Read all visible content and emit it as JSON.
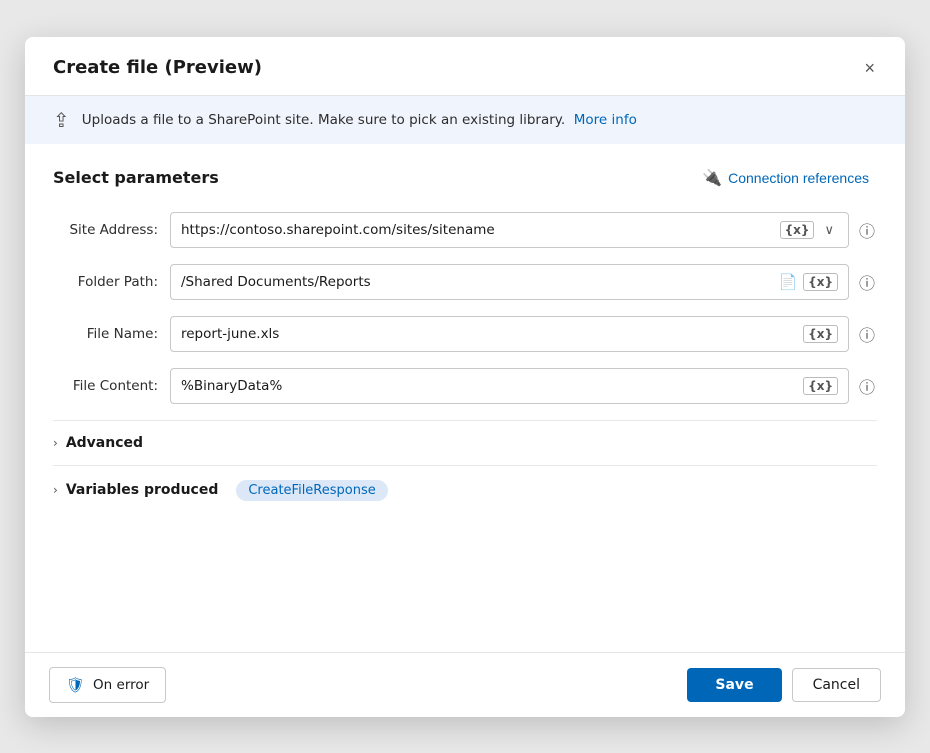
{
  "dialog": {
    "title": "Create file (Preview)",
    "close_label": "×"
  },
  "info_banner": {
    "text": "Uploads a file to a SharePoint site. Make sure to pick an existing library.",
    "link_text": "More info"
  },
  "section": {
    "title": "Select parameters",
    "connection_references_label": "Connection references"
  },
  "fields": [
    {
      "label": "Site Address:",
      "value": "https://contoso.sharepoint.com/sites/sitename",
      "badge": "{x}",
      "has_chevron": true,
      "has_file_icon": false,
      "info": true
    },
    {
      "label": "Folder Path:",
      "value": "/Shared Documents/Reports",
      "badge": "{x}",
      "has_chevron": false,
      "has_file_icon": true,
      "info": true
    },
    {
      "label": "File Name:",
      "value": "report-june.xls",
      "badge": "{x}",
      "has_chevron": false,
      "has_file_icon": false,
      "info": true
    },
    {
      "label": "File Content:",
      "value": "%BinaryData%",
      "badge": "{x}",
      "has_chevron": false,
      "has_file_icon": false,
      "info": true
    }
  ],
  "collapsible": {
    "advanced_label": "Advanced",
    "variables_label": "Variables produced",
    "variable_badge": "CreateFileResponse"
  },
  "footer": {
    "on_error_label": "On error",
    "save_label": "Save",
    "cancel_label": "Cancel"
  }
}
